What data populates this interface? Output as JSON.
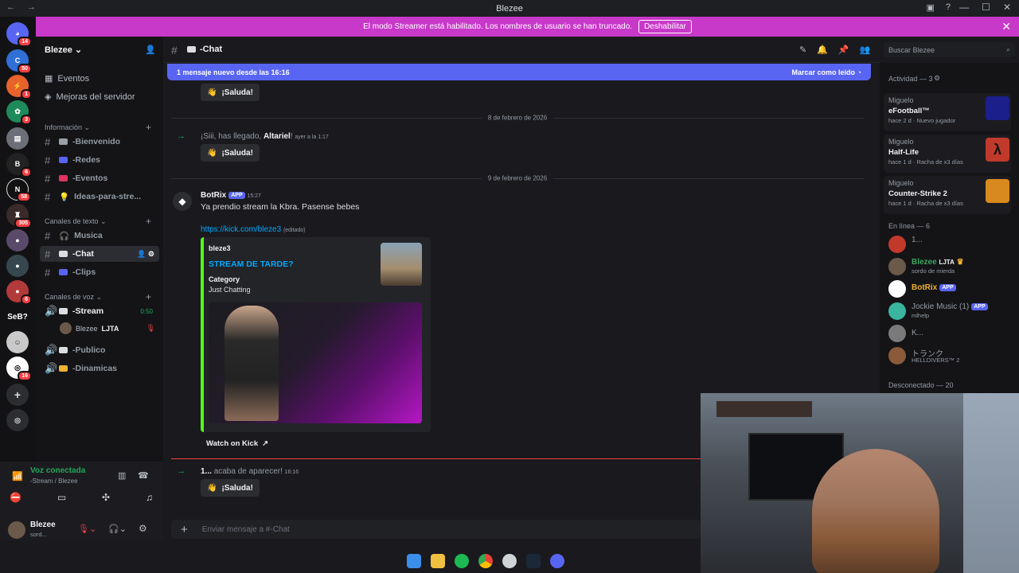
{
  "window": {
    "title": "Blezee"
  },
  "banner": {
    "text": "El modo Streamer está habilitado. Los nombres de usuario se han truncado.",
    "button": "Deshabilitar"
  },
  "guild_badges": [
    "14",
    "50",
    "1",
    "3",
    "",
    "6",
    "58",
    "305",
    "",
    "6",
    "",
    "16"
  ],
  "guild_labels": {
    "seb": "SeB?"
  },
  "server": {
    "name": "Blezee",
    "top_items": [
      "Eventos",
      "Mejoras del servidor"
    ],
    "cat_info": "Información",
    "info_channels": [
      {
        "name": "-Bienvenido",
        "color": "#9aa0a6"
      },
      {
        "name": "-Redes",
        "color": "#5865f2"
      },
      {
        "name": "-Eventos",
        "color": "#e0335f"
      },
      {
        "name": "Ideas-para-stre...",
        "color": "#f0b232"
      }
    ],
    "cat_text": "Canales de texto",
    "text_channels": [
      {
        "name": "Musica",
        "color": "#b5bac1"
      },
      {
        "name": "-Chat",
        "color": "#dbdee1"
      },
      {
        "name": "-Clips",
        "color": "#5865f2"
      }
    ],
    "cat_voice": "Canales de voz",
    "voice_channels": [
      {
        "name": "-Stream",
        "timer": "0:50"
      },
      {
        "name": "-Publico",
        "timer": ""
      },
      {
        "name": "-Dinamicas",
        "timer": ""
      }
    ],
    "voice_user": {
      "name": "Blezee",
      "tag": "LJTA"
    }
  },
  "voice": {
    "status": "Voz conectada",
    "location": "-Stream / Blezee"
  },
  "user": {
    "name": "Blezee",
    "status": "sord..."
  },
  "channel": {
    "name": "-Chat",
    "newbar_text": "1 mensaje nuevo desde las 16:16",
    "newbar_action": "Marcar como leído",
    "search_placeholder": "Buscar Blezee",
    "input_placeholder": "Enviar mensaje a #-Chat"
  },
  "messages": {
    "saluda": "¡Saluda!",
    "date1": "8 de febrero de 2026",
    "join1_text": "¡Siii, has llegado,",
    "join1_user": "Altariel",
    "join1_time": "ayer a la 1:17",
    "date2": "9 de febrero de 2026",
    "bot_name": "BotRix",
    "bot_tag": "APP",
    "bot_time": "15:27",
    "bot_text": "Ya prendio stream la Kbra. Pasense bebes",
    "link": "https://kick.com/bleze3",
    "link_edit": "(editado)",
    "embed_author": "bleze3",
    "embed_title": "STREAM DE TARDE?",
    "embed_field_name": "Category",
    "embed_field_value": "Just Chatting",
    "embed_button": "Watch on Kick",
    "join2_user": "1...",
    "join2_text": "acaba de aparecer!",
    "join2_time": "16:16"
  },
  "members": {
    "activity_header": "Actividad — 3",
    "activities": [
      {
        "user": "Miguelo",
        "game": "eFootball™",
        "meta": "hace 2 d",
        "meta2": "Nuevo jugador",
        "color": "#1a1f8c"
      },
      {
        "user": "Miguelo",
        "game": "Half-Life",
        "meta": "hace 1 d",
        "meta2": "Racha de x3 días",
        "color": "#c0392b"
      },
      {
        "user": "Miguelo",
        "game": "Counter-Strike 2",
        "meta": "hace 1 d",
        "meta2": "Racha de x3 días",
        "color": "#d88a1e"
      }
    ],
    "online_header": "En línea — 6",
    "online": [
      {
        "name": "1...",
        "status": "",
        "color": "#949ba4",
        "app": ""
      },
      {
        "name": "Blezee",
        "status": "sordo de mierda",
        "color": "#3ba55d",
        "app": "LJTA"
      },
      {
        "name": "BotRix",
        "status": "",
        "color": "#f0b232",
        "app": "APP"
      },
      {
        "name": "Jockie Music (1)",
        "status": "mlhelp",
        "color": "#949ba4",
        "app": "APP"
      },
      {
        "name": "K...",
        "status": "",
        "color": "#949ba4",
        "app": ""
      },
      {
        "name": "トランク",
        "status": "HELLDIVERS™ 2",
        "color": "#949ba4",
        "app": ""
      }
    ],
    "offline_header": "Desconectado — 20"
  }
}
